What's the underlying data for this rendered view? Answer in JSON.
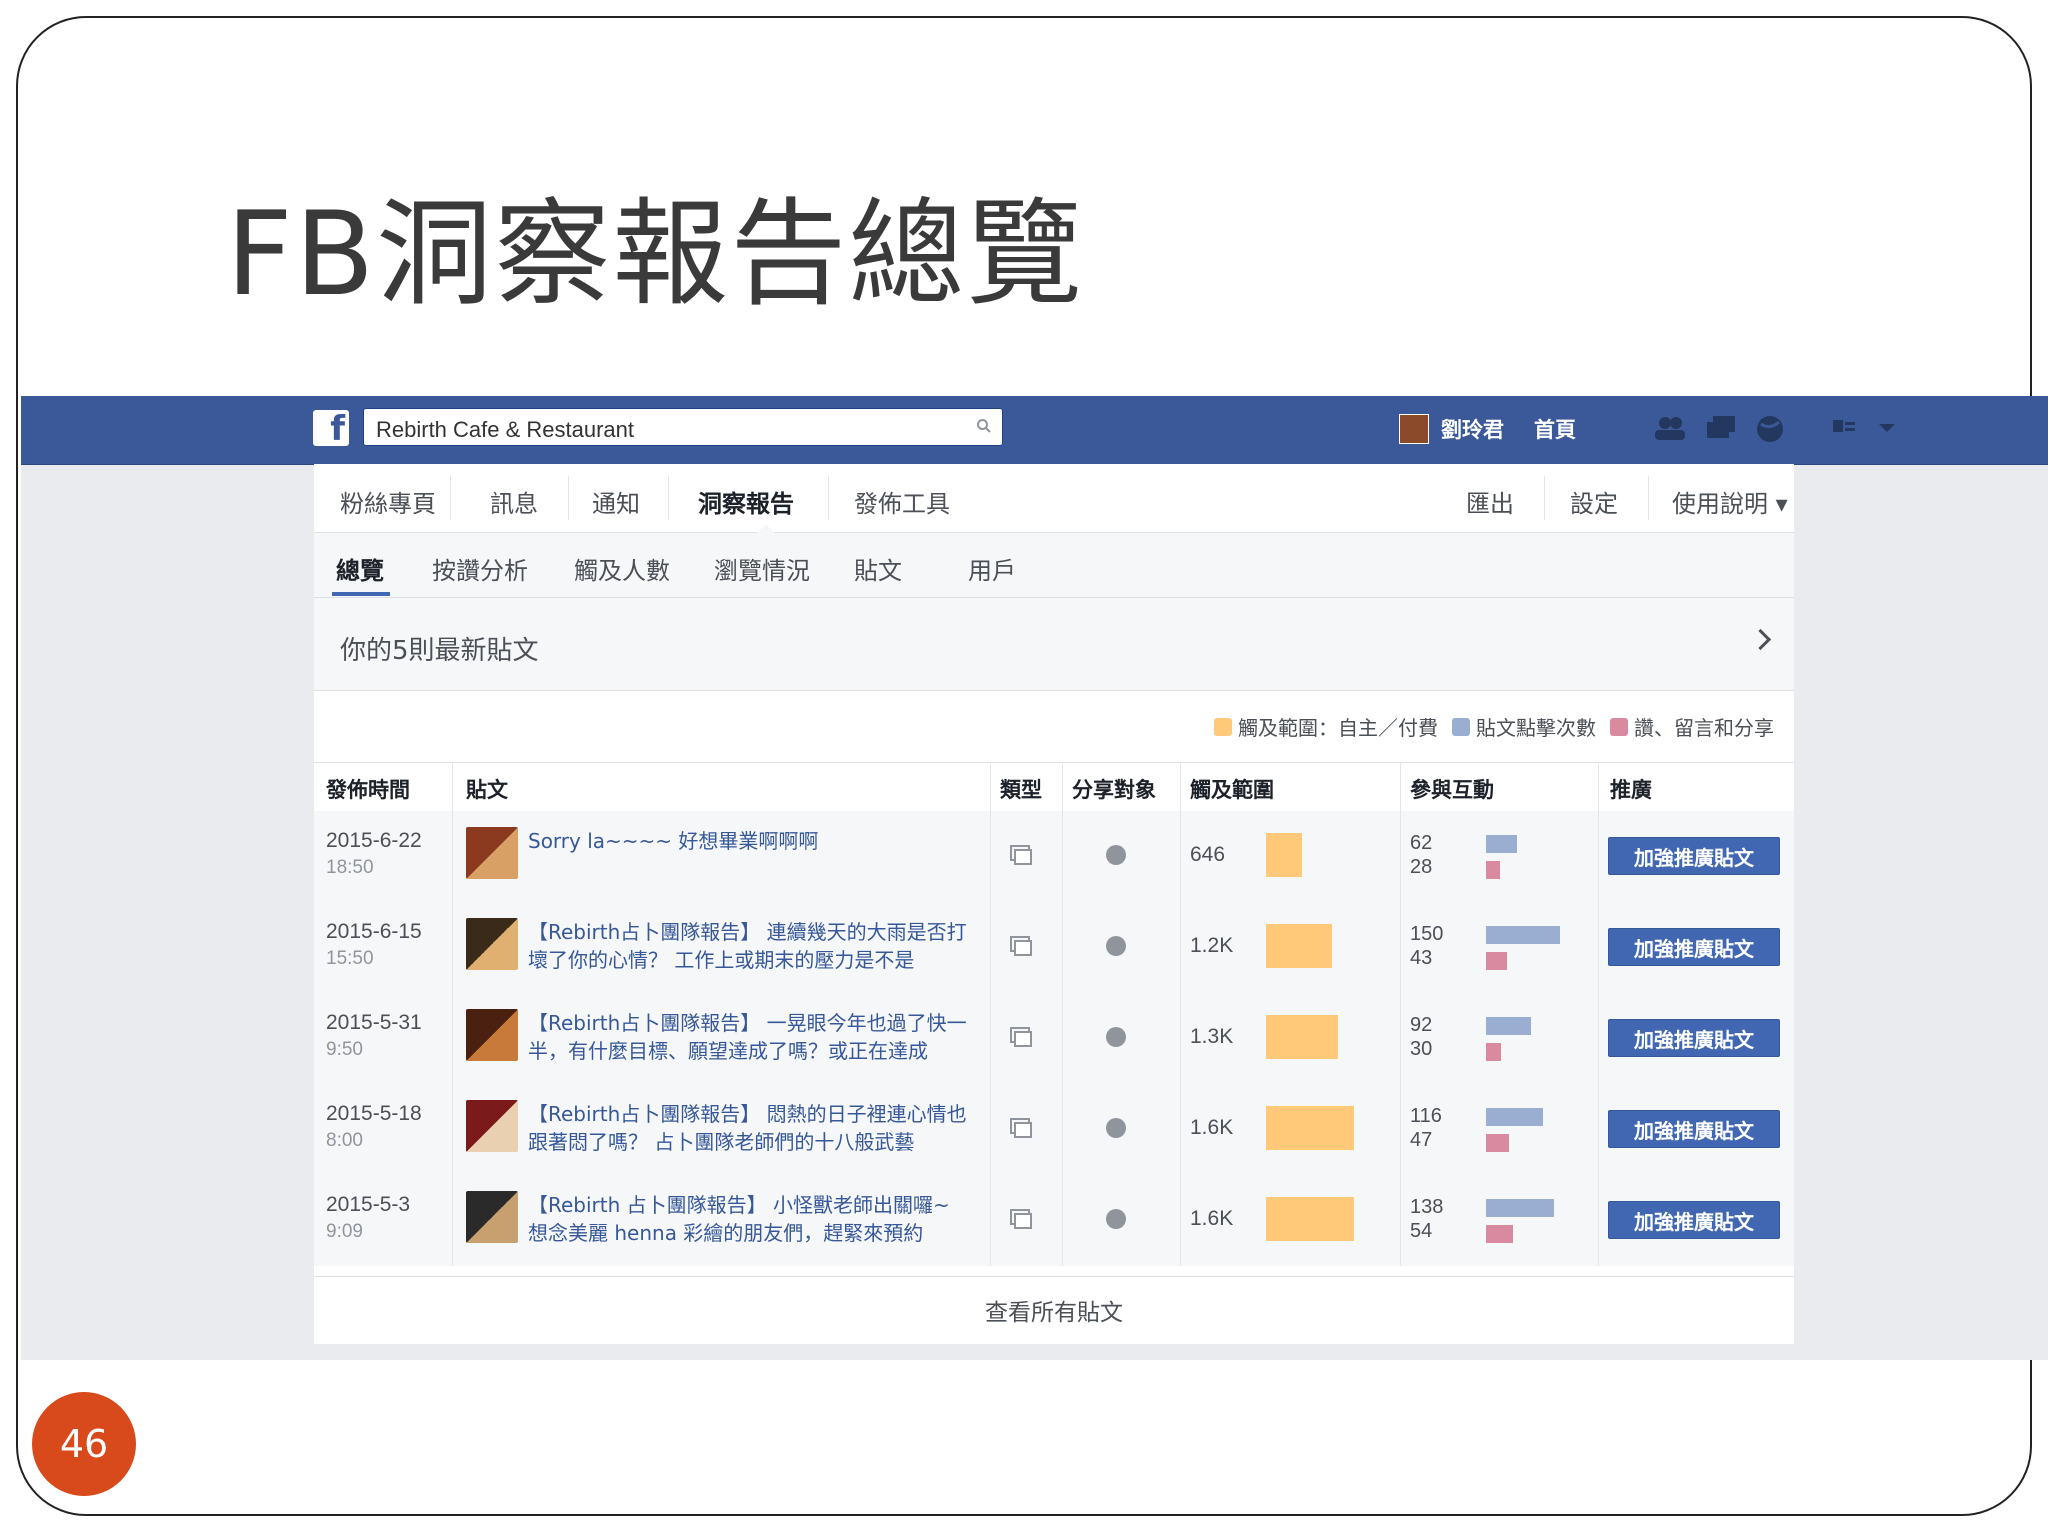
{
  "slide": {
    "title": "FB洞察報告總覽",
    "page_number": "46"
  },
  "fb_header": {
    "search_value": "Rebirth Cafe & Restaurant",
    "user_name": "劉玲君",
    "home_label": "首頁",
    "icons": [
      "friends-icon",
      "messages-icon",
      "globe-notifications-icon",
      "privacy-icon",
      "dropdown-icon"
    ]
  },
  "page_nav": {
    "items": [
      "粉絲專頁",
      "訊息",
      "通知",
      "洞察報告",
      "發佈工具"
    ],
    "active": "洞察報告",
    "right_items": [
      "匯出",
      "設定",
      "使用說明 ▾"
    ]
  },
  "sub_nav": {
    "items": [
      "總覽",
      "按讚分析",
      "觸及人數",
      "瀏覽情況",
      "貼文",
      "用戶"
    ],
    "active": "總覽"
  },
  "section": {
    "title": "你的5則最新貼文"
  },
  "legend": {
    "reach": "觸及範圍：自主／付費",
    "clicks": "貼文點擊次數",
    "likes": "讚、留言和分享",
    "colors": {
      "reach": "#ffc979",
      "clicks": "#9aaed1",
      "likes": "#d98aa0"
    }
  },
  "table": {
    "headers": [
      "發佈時間",
      "貼文",
      "類型",
      "分享對象",
      "觸及範圍",
      "參與互動",
      "推廣"
    ],
    "rows": [
      {
        "date": "2015-6-22",
        "time": "18:50",
        "post": "Sorry la~~~~ 好想畢業啊啊啊",
        "reach": "646",
        "reach_num": 646,
        "clicks": "62",
        "likes": "28",
        "boost": "加強推廣貼文"
      },
      {
        "date": "2015-6-15",
        "time": "15:50",
        "post": "【Rebirth占卜團隊報告】 連續幾天的大雨是否打壞了你的心情？ 工作上或期末的壓力是不是",
        "reach": "1.2K",
        "reach_num": 1200,
        "clicks": "150",
        "likes": "43",
        "boost": "加強推廣貼文"
      },
      {
        "date": "2015-5-31",
        "time": "9:50",
        "post": "【Rebirth占卜團隊報告】 一晃眼今年也過了快一半，有什麼目標、願望達成了嗎？或正在達成",
        "reach": "1.3K",
        "reach_num": 1300,
        "clicks": "92",
        "likes": "30",
        "boost": "加強推廣貼文"
      },
      {
        "date": "2015-5-18",
        "time": "8:00",
        "post": "【Rebirth占卜團隊報告】 悶熱的日子裡連心情也跟著悶了嗎？ 占卜團隊老師們的十八般武藝",
        "reach": "1.6K",
        "reach_num": 1600,
        "clicks": "116",
        "likes": "47",
        "boost": "加強推廣貼文"
      },
      {
        "date": "2015-5-3",
        "time": "9:09",
        "post": "【Rebirth 占卜團隊報告】 小怪獸老師出關囉~ 想念美麗 henna 彩繪的朋友們，趕緊來預約",
        "reach": "1.6K",
        "reach_num": 1600,
        "clicks": "138",
        "likes": "54",
        "boost": "加強推廣貼文"
      }
    ],
    "footer_link": "查看所有貼文"
  }
}
